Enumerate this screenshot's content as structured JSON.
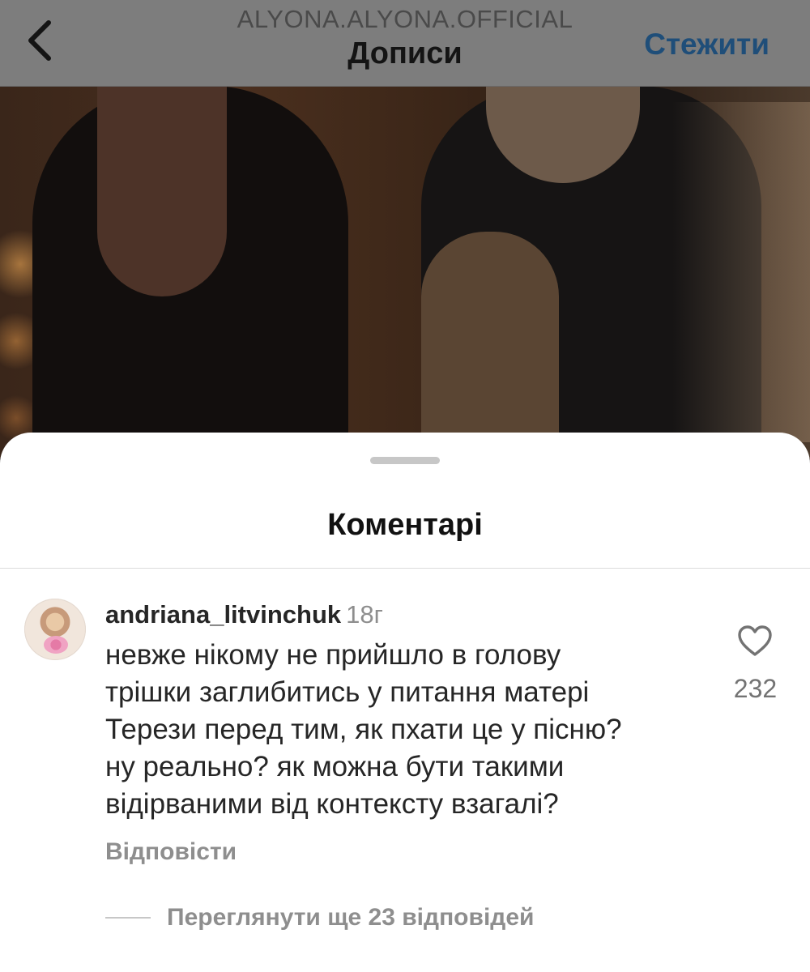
{
  "header": {
    "username": "ALYONA.ALYONA.OFFICIAL",
    "title": "Дописи",
    "follow_label": "Стежити",
    "back_icon": "chevron-left-icon"
  },
  "sheet": {
    "title": "Коментарі"
  },
  "comment": {
    "username": "andriana_litvinchuk",
    "time": "18г",
    "text_lines": [
      "невже нікому не прийшло в голову",
      "трішки заглибитись у питання матері",
      "Терези перед тим, як пхати це у пісню?",
      "ну реально? як можна бути такими",
      "відірваними від контексту взагалі?"
    ],
    "like_count": "232",
    "like_icon": "heart-outline-icon",
    "reply_label": "Відповісти",
    "view_replies_label": "Переглянути ще 23 відповідей"
  },
  "colors": {
    "follow": "#1f4e79",
    "secondary_text": "#8e8e8e",
    "primary_text": "#262626"
  }
}
